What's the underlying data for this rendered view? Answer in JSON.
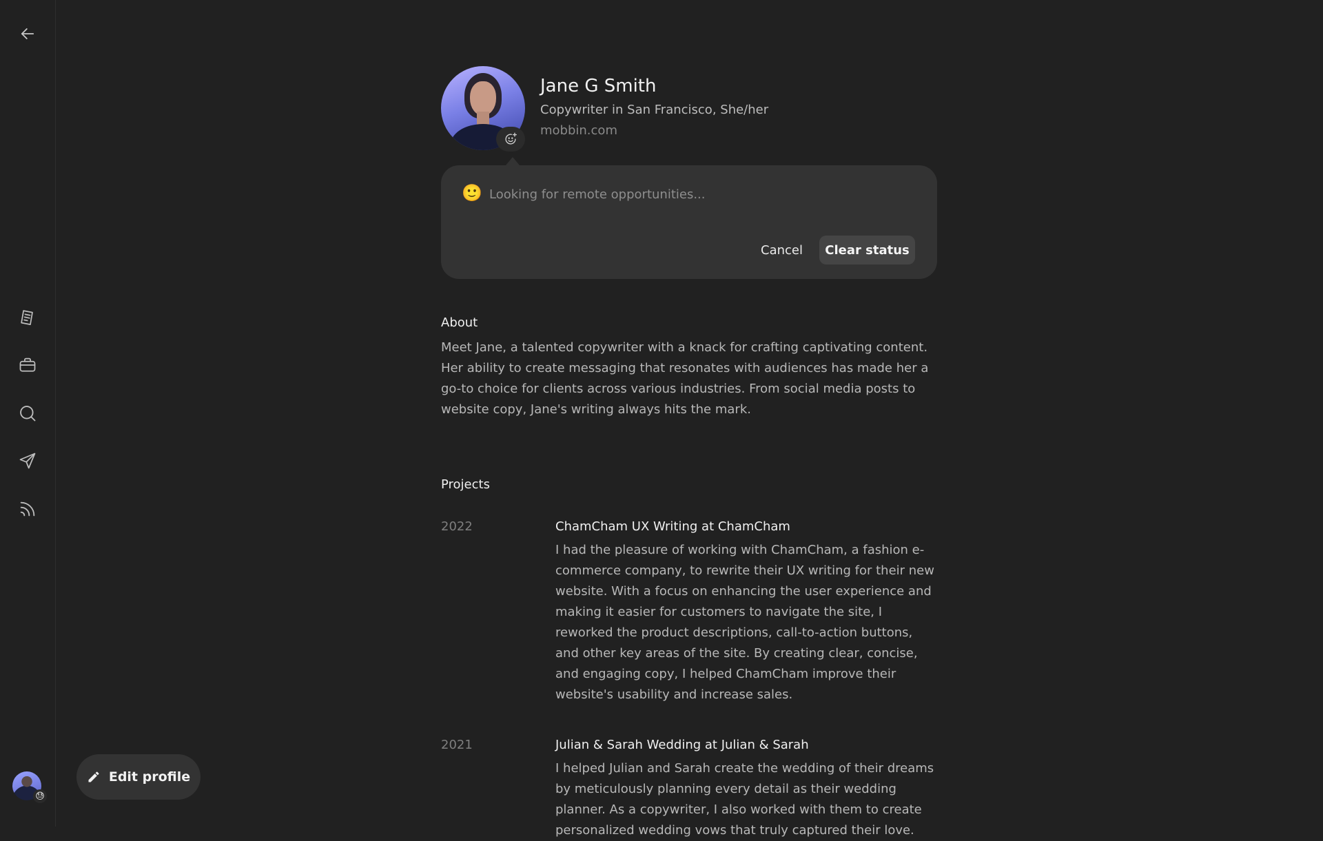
{
  "sidebar": {
    "items": [
      {
        "icon": "back-arrow-icon"
      },
      {
        "icon": "document-icon"
      },
      {
        "icon": "briefcase-icon"
      },
      {
        "icon": "search-icon"
      },
      {
        "icon": "send-icon"
      },
      {
        "icon": "feed-icon"
      }
    ],
    "avatar_status_emoji": "😓"
  },
  "edit_profile": {
    "label": "Edit profile",
    "icon": "pencil-icon"
  },
  "profile": {
    "name": "Jane G Smith",
    "subtitle": "Copywriter in San Francisco, She/her",
    "website": "mobbin.com"
  },
  "status": {
    "emoji": "🙂",
    "placeholder": "Looking for remote opportunities...",
    "value": "",
    "cancel_label": "Cancel",
    "clear_label": "Clear status"
  },
  "about": {
    "heading": "About",
    "text": "Meet Jane, a talented copywriter with a knack for crafting captivating content. Her ability to create messaging that resonates with audiences has made her a go-to choice for clients across various industries. From social media posts to website copy, Jane's writing always hits the mark."
  },
  "projects": {
    "heading": "Projects",
    "items": [
      {
        "year": "2022",
        "title": "ChamCham UX Writing at ChamCham",
        "description": "I had the pleasure of working with ChamCham, a fashion e-commerce company, to rewrite their UX writing for their new website. With a focus on enhancing the user experience and making it easier for customers to navigate the site, I reworked the product descriptions, call-to-action buttons, and other key areas of the site. By creating clear, concise, and engaging copy, I helped ChamCham improve their website's usability and increase sales."
      },
      {
        "year": "2021",
        "title": "Julian & Sarah Wedding at Julian & Sarah",
        "description": "I helped Julian and Sarah create the wedding of their dreams by meticulously planning every detail as their wedding planner. As a copywriter, I also worked with them to create personalized wedding vows that truly captured their love."
      }
    ]
  },
  "colors": {
    "background": "#212121",
    "card": "#333333",
    "text_primary": "#f0f0f0",
    "text_secondary": "#b8b8b8",
    "text_muted": "#7f7f7f"
  }
}
